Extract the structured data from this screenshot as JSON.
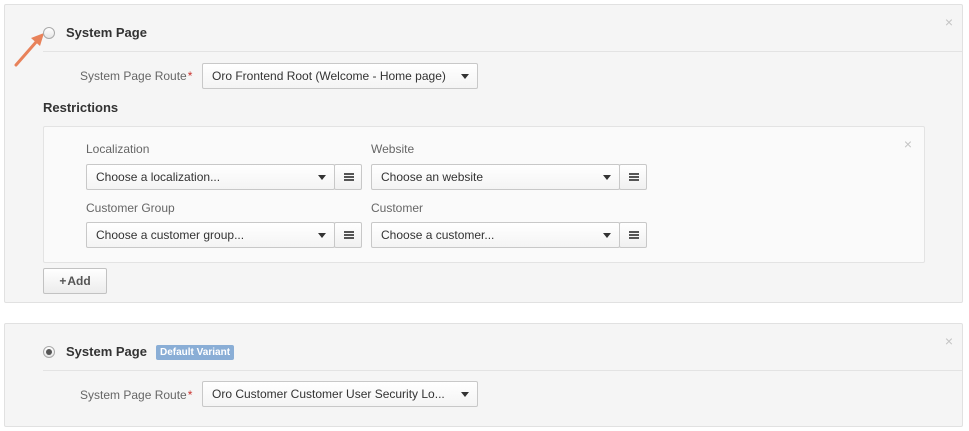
{
  "variant1": {
    "title": "System Page",
    "close_icon": "×",
    "route_label": "System Page Route",
    "required_mark": "*",
    "route_value": "Oro Frontend Root (Welcome - Home page)",
    "restrictions_title": "Restrictions",
    "restrictions": {
      "close_icon": "×",
      "localization": {
        "label": "Localization",
        "placeholder": "Choose a localization..."
      },
      "website": {
        "label": "Website",
        "placeholder": "Choose an website"
      },
      "customer_group": {
        "label": "Customer Group",
        "placeholder": "Choose a customer group..."
      },
      "customer": {
        "label": "Customer",
        "placeholder": "Choose a customer..."
      }
    },
    "add_button": {
      "plus": "+",
      "label": "Add"
    }
  },
  "variant2": {
    "title": "System Page",
    "badge": "Default Variant",
    "close_icon": "×",
    "route_label": "System Page Route",
    "required_mark": "*",
    "route_value": "Oro Customer Customer User Security Lo..."
  },
  "colors": {
    "accent_arrow": "#e8825a",
    "badge": "#8aaed6",
    "required": "#c9302c"
  },
  "icons": {
    "arrow": "pointer-arrow-icon",
    "caret": "chevron-down-icon",
    "menu": "hamburger-icon",
    "close": "close-icon"
  }
}
